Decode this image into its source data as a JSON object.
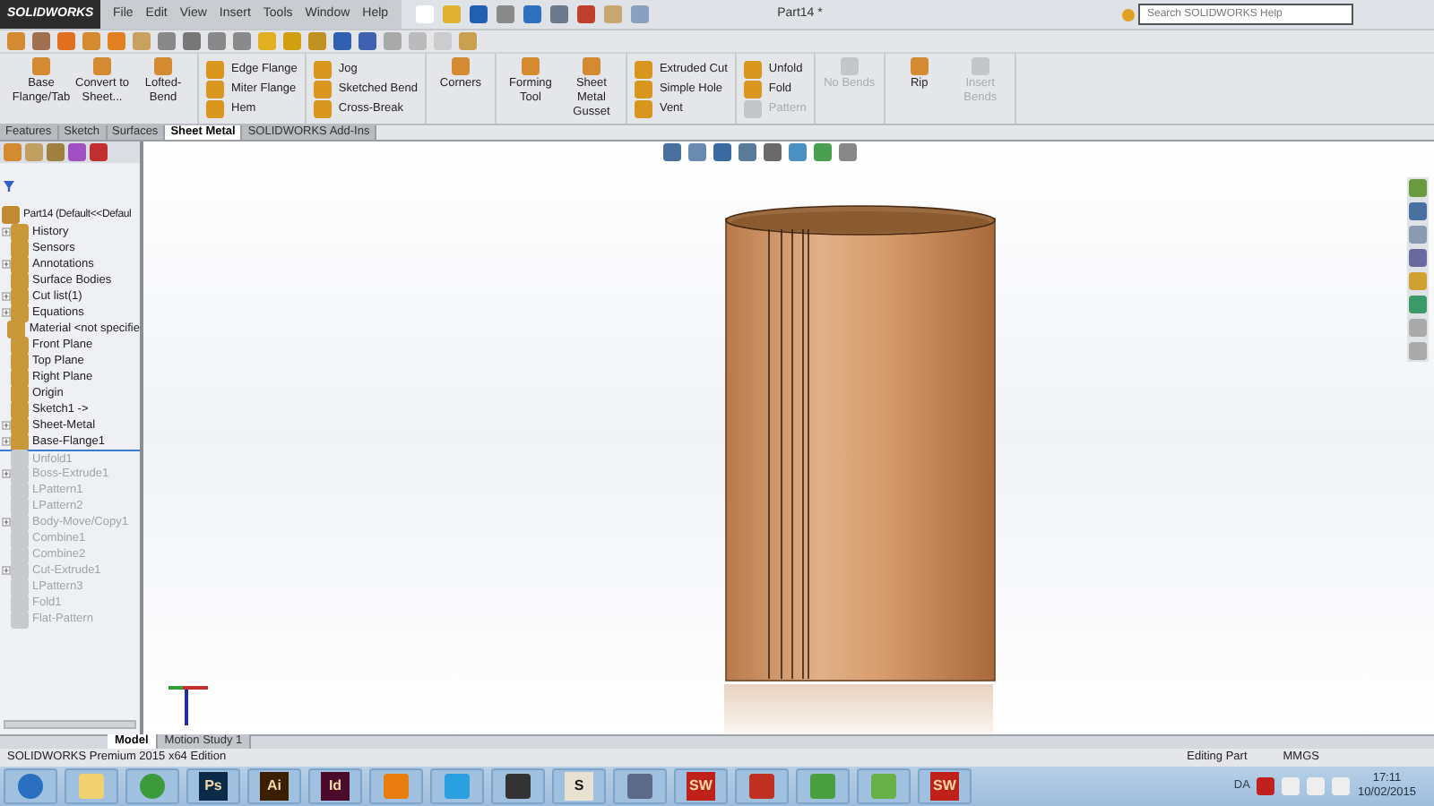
{
  "app": {
    "logo": "SOLIDWORKS",
    "menu": [
      "File",
      "Edit",
      "View",
      "Insert",
      "Tools",
      "Window",
      "Help"
    ],
    "title": "Part14 *",
    "search": {
      "placeholder": "Search SOLIDWORKS Help"
    }
  },
  "ribbon": [
    {
      "kind": "large",
      "items": [
        {
          "label": "Base Flange/Tab",
          "disabled": false
        },
        {
          "label": "Convert to Sheet...",
          "disabled": false
        },
        {
          "label": "Lofted-Bend",
          "disabled": false
        }
      ]
    },
    {
      "kind": "small",
      "items": [
        {
          "label": "Edge Flange",
          "disabled": false
        },
        {
          "label": "Miter Flange",
          "disabled": false
        },
        {
          "label": "Hem",
          "disabled": false
        }
      ]
    },
    {
      "kind": "small",
      "items": [
        {
          "label": "Jog",
          "disabled": false
        },
        {
          "label": "Sketched Bend",
          "disabled": false
        },
        {
          "label": "Cross-Break",
          "disabled": false
        }
      ]
    },
    {
      "kind": "large",
      "items": [
        {
          "label": "Corners",
          "disabled": false
        }
      ]
    },
    {
      "kind": "large",
      "items": [
        {
          "label": "Forming Tool",
          "disabled": false
        },
        {
          "label": "Sheet Metal Gusset",
          "disabled": false
        }
      ]
    },
    {
      "kind": "small",
      "items": [
        {
          "label": "Extruded Cut",
          "disabled": false
        },
        {
          "label": "Simple Hole",
          "disabled": false
        },
        {
          "label": "Vent",
          "disabled": false
        }
      ]
    },
    {
      "kind": "small",
      "items": [
        {
          "label": "Unfold",
          "disabled": false
        },
        {
          "label": "Fold",
          "disabled": false
        },
        {
          "label": "Pattern",
          "disabled": true
        }
      ]
    },
    {
      "kind": "large",
      "items": [
        {
          "label": "No Bends",
          "disabled": true
        }
      ]
    },
    {
      "kind": "large",
      "items": [
        {
          "label": "Rip",
          "disabled": false
        },
        {
          "label": "Insert Bends",
          "disabled": true
        }
      ]
    }
  ],
  "command_tabs": [
    {
      "label": "Features",
      "selected": false
    },
    {
      "label": "Sketch",
      "selected": false
    },
    {
      "label": "Surfaces",
      "selected": false
    },
    {
      "label": "Sheet Metal",
      "selected": true
    },
    {
      "label": "SOLIDWORKS Add-Ins",
      "selected": false
    }
  ],
  "tree": {
    "root": "Part14  (Default<<Defaul",
    "items": [
      {
        "label": "History",
        "expandable": true,
        "disabled": false
      },
      {
        "label": "Sensors",
        "expandable": false,
        "disabled": false
      },
      {
        "label": "Annotations",
        "expandable": true,
        "disabled": false
      },
      {
        "label": "Surface Bodies",
        "expandable": false,
        "disabled": false
      },
      {
        "label": "Cut list(1)",
        "expandable": true,
        "disabled": false
      },
      {
        "label": "Equations",
        "expandable": true,
        "disabled": false
      },
      {
        "label": "Material <not specifie",
        "expandable": false,
        "disabled": false
      },
      {
        "label": "Front Plane",
        "expandable": false,
        "disabled": false
      },
      {
        "label": "Top Plane",
        "expandable": false,
        "disabled": false
      },
      {
        "label": "Right Plane",
        "expandable": false,
        "disabled": false
      },
      {
        "label": "Origin",
        "expandable": false,
        "disabled": false
      },
      {
        "label": "Sketch1 ->",
        "expandable": false,
        "disabled": false
      },
      {
        "label": "Sheet-Metal",
        "expandable": true,
        "disabled": false
      },
      {
        "label": "Base-Flange1",
        "expandable": true,
        "disabled": false
      },
      {
        "label": "Unfold1",
        "expandable": false,
        "disabled": true
      },
      {
        "label": "Boss-Extrude1",
        "expandable": true,
        "disabled": true
      },
      {
        "label": "LPattern1",
        "expandable": false,
        "disabled": true
      },
      {
        "label": "LPattern2",
        "expandable": false,
        "disabled": true
      },
      {
        "label": "Body-Move/Copy1",
        "expandable": true,
        "disabled": true
      },
      {
        "label": "Combine1",
        "expandable": false,
        "disabled": true
      },
      {
        "label": "Combine2",
        "expandable": false,
        "disabled": true
      },
      {
        "label": "Cut-Extrude1",
        "expandable": true,
        "disabled": true
      },
      {
        "label": "LPattern3",
        "expandable": false,
        "disabled": true
      },
      {
        "label": "Fold1",
        "expandable": false,
        "disabled": true
      },
      {
        "label": "Flat-Pattern",
        "expandable": false,
        "disabled": true
      }
    ]
  },
  "bottom_tabs": [
    {
      "label": "Model",
      "selected": true
    },
    {
      "label": "Motion Study 1",
      "selected": false
    }
  ],
  "status_bar": {
    "edition": "SOLIDWORKS Premium 2015 x64 Edition",
    "mode": "Editing Part",
    "units": "MMGS"
  },
  "taskbar": {
    "apps": [
      {
        "kind": "start"
      },
      {
        "kind": "folder"
      },
      {
        "kind": "browser"
      },
      {
        "kind": "letter",
        "label": "Ps",
        "color": "#0b2a4a"
      },
      {
        "kind": "letter",
        "label": "Ai",
        "color": "#3a1f00"
      },
      {
        "kind": "letter",
        "label": "Id",
        "color": "#4a0a2a"
      },
      {
        "kind": "blender"
      },
      {
        "kind": "arrow"
      },
      {
        "kind": "inkscape"
      },
      {
        "kind": "letter",
        "label": "S",
        "color": "#e8e0d0"
      },
      {
        "kind": "box"
      },
      {
        "kind": "letter",
        "label": "SW",
        "color": "#c0201a"
      },
      {
        "kind": "gear"
      },
      {
        "kind": "sheet"
      },
      {
        "kind": "check"
      },
      {
        "kind": "letter",
        "label": "SW",
        "color": "#c0201a"
      }
    ],
    "language": "DA",
    "time": "17:11",
    "date": "10/02/2015"
  }
}
